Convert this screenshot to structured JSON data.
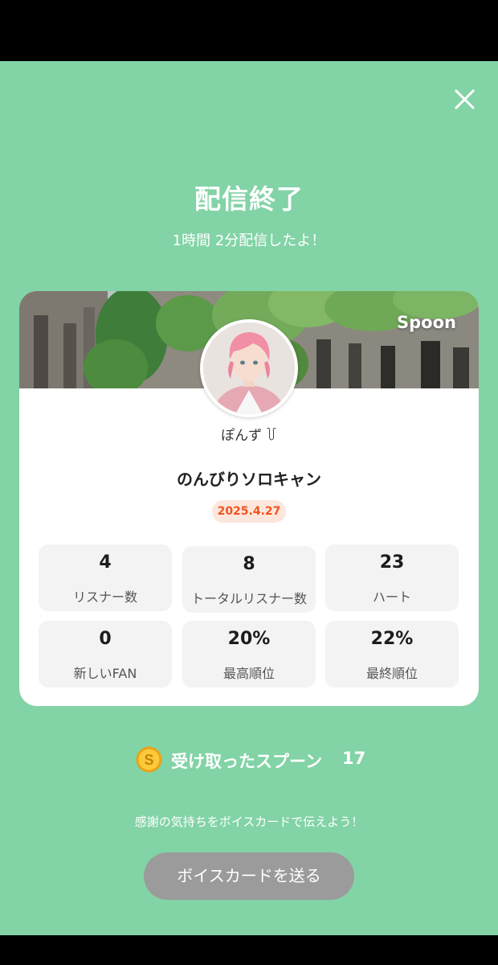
{
  "header": {
    "title": "配信終了",
    "subtitle": "1時間 2分配信したよ！"
  },
  "card": {
    "brand": "Spoon",
    "username": "ぽんず ꒦",
    "stream_title": "のんびりソロキャン",
    "date": "2025.4.27"
  },
  "stats": [
    {
      "value": "4",
      "label": "リスナー数"
    },
    {
      "value": "8",
      "label": "トータルリスナー数"
    },
    {
      "value": "23",
      "label": "ハート"
    },
    {
      "value": "0",
      "label": "新しいFAN"
    },
    {
      "value": "20%",
      "label": "最高順位"
    },
    {
      "value": "22%",
      "label": "最終順位"
    }
  ],
  "spoons": {
    "label": "受け取ったスプーン",
    "count": "17"
  },
  "footer": {
    "thanks_text": "感謝の気持ちをボイスカードで伝えよう！",
    "voice_card_button": "ボイスカードを送る"
  },
  "colors": {
    "background": "#82d3a6",
    "date_accent": "#f2541d",
    "button_gray": "#9b9b9b"
  },
  "icons": {
    "close": "close-icon",
    "coin": "spoon-coin-icon"
  }
}
